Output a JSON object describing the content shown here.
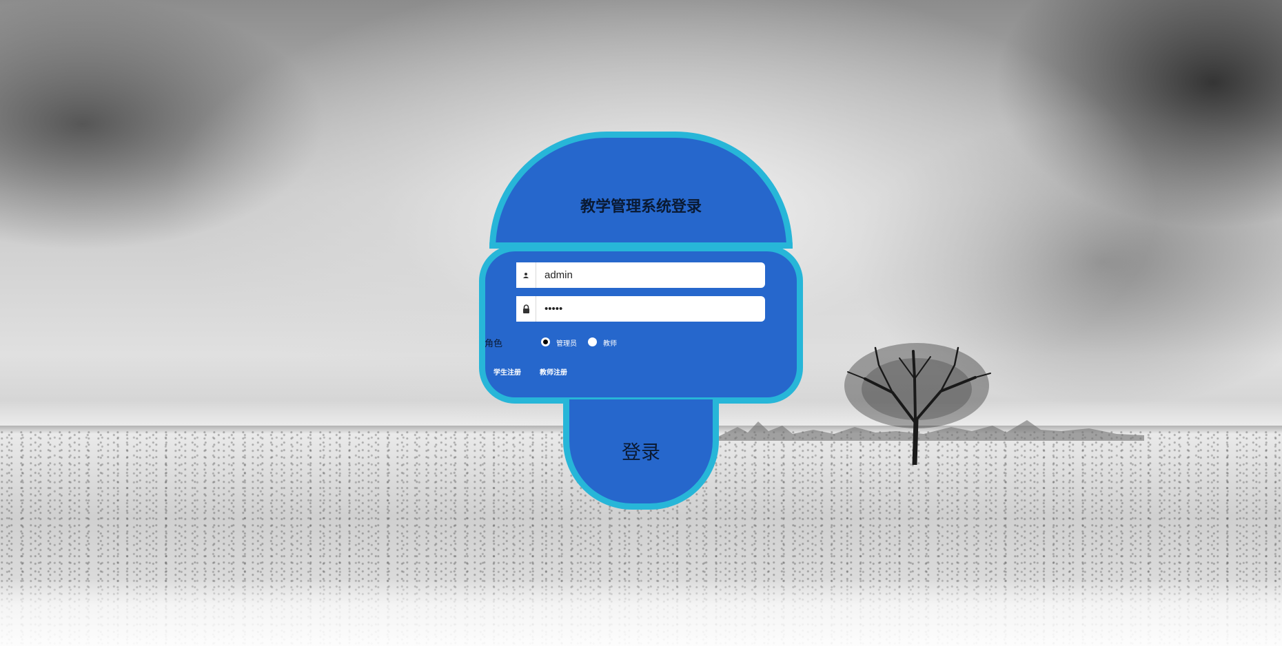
{
  "login": {
    "title": "教学管理系统登录",
    "username": {
      "value": "admin",
      "icon": "user-icon"
    },
    "password": {
      "value": "•••••",
      "icon": "lock-icon"
    },
    "role": {
      "label": "角色",
      "options": [
        "管理员",
        "教师"
      ],
      "selected": "管理员"
    },
    "links": {
      "student_register": "学生注册",
      "teacher_register": "教师注册"
    },
    "submit_label": "登录"
  },
  "colors": {
    "panel": "#2667cc",
    "border": "#27b6d8"
  }
}
